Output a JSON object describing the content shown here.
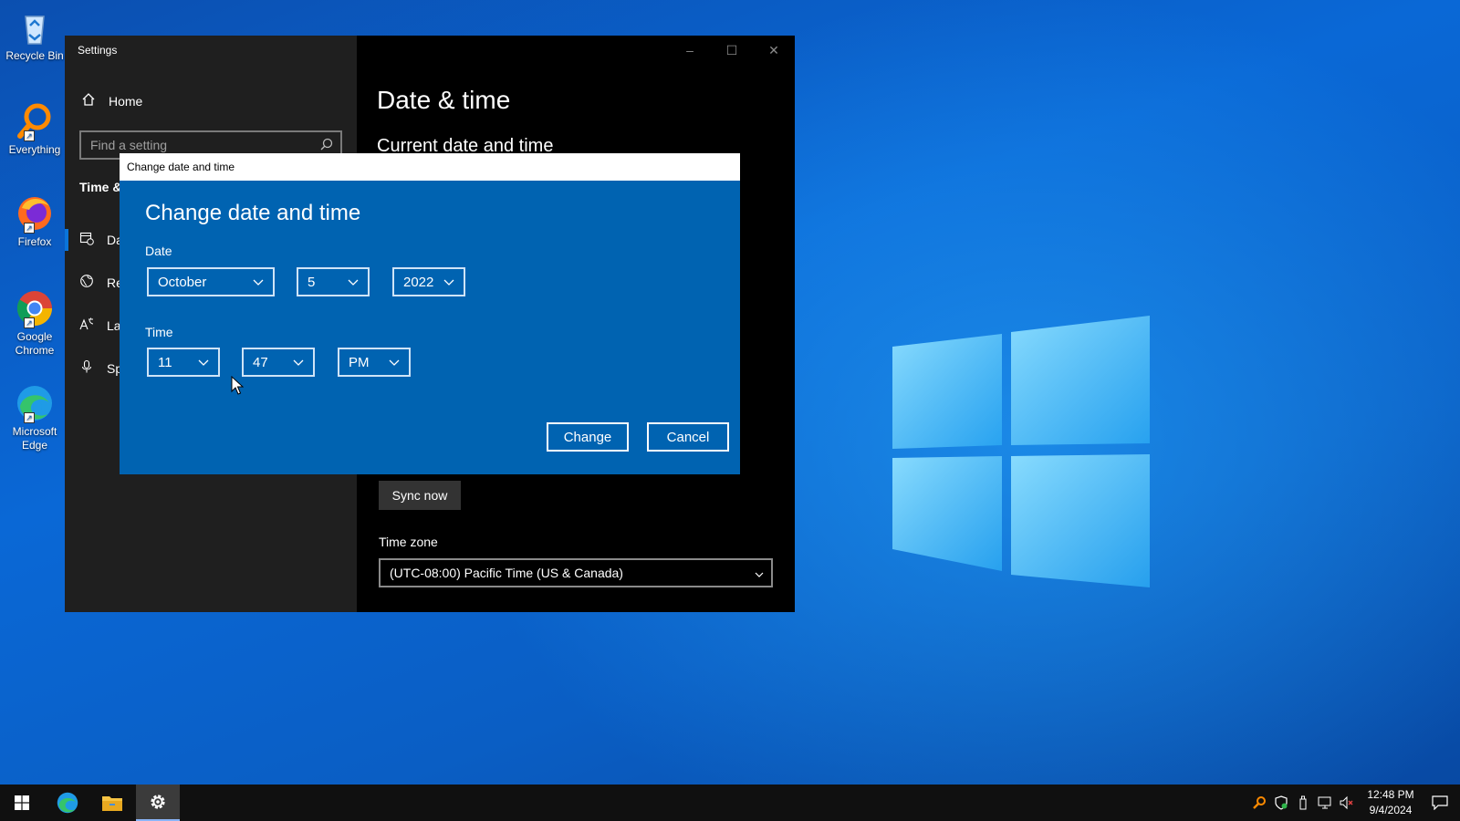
{
  "desktop": {
    "icons": [
      {
        "label": "Recycle Bin",
        "icon": "recycle-bin-icon"
      },
      {
        "label": "Everything",
        "icon": "everything-search-icon"
      },
      {
        "label": "Firefox",
        "icon": "firefox-icon"
      },
      {
        "label": "Google Chrome",
        "icon": "chrome-icon"
      },
      {
        "label": "Microsoft Edge",
        "icon": "edge-icon"
      }
    ]
  },
  "settings": {
    "window_title": "Settings",
    "controls": {
      "minimize": "–",
      "maximize": "☐",
      "close": "✕"
    },
    "home_label": "Home",
    "search_placeholder": "Find a setting",
    "section_label": "Time &",
    "nav_items": [
      "Da",
      "Re",
      "La",
      "Sp"
    ],
    "page_title": "Date & time",
    "current_section": "Current date and time",
    "sync_label": "Sync now",
    "timezone_label": "Time zone",
    "timezone_value": "(UTC-08:00) Pacific Time (US & Canada)"
  },
  "dialog": {
    "title_bar": "Change date and time",
    "heading": "Change date and time",
    "date_label": "Date",
    "month": "October",
    "day": "5",
    "year": "2022",
    "time_label": "Time",
    "hour": "11",
    "minute": "47",
    "ampm": "PM",
    "change_label": "Change",
    "cancel_label": "Cancel"
  },
  "taskbar": {
    "pinned": [
      "start-icon",
      "edge-icon",
      "file-explorer-icon",
      "settings-gear-icon"
    ],
    "time": "12:48 PM",
    "date": "9/4/2024"
  },
  "colors": {
    "dialog_blue": "#0063b1",
    "accent": "#0a74da",
    "desktop_blue": "#0a68d6"
  }
}
